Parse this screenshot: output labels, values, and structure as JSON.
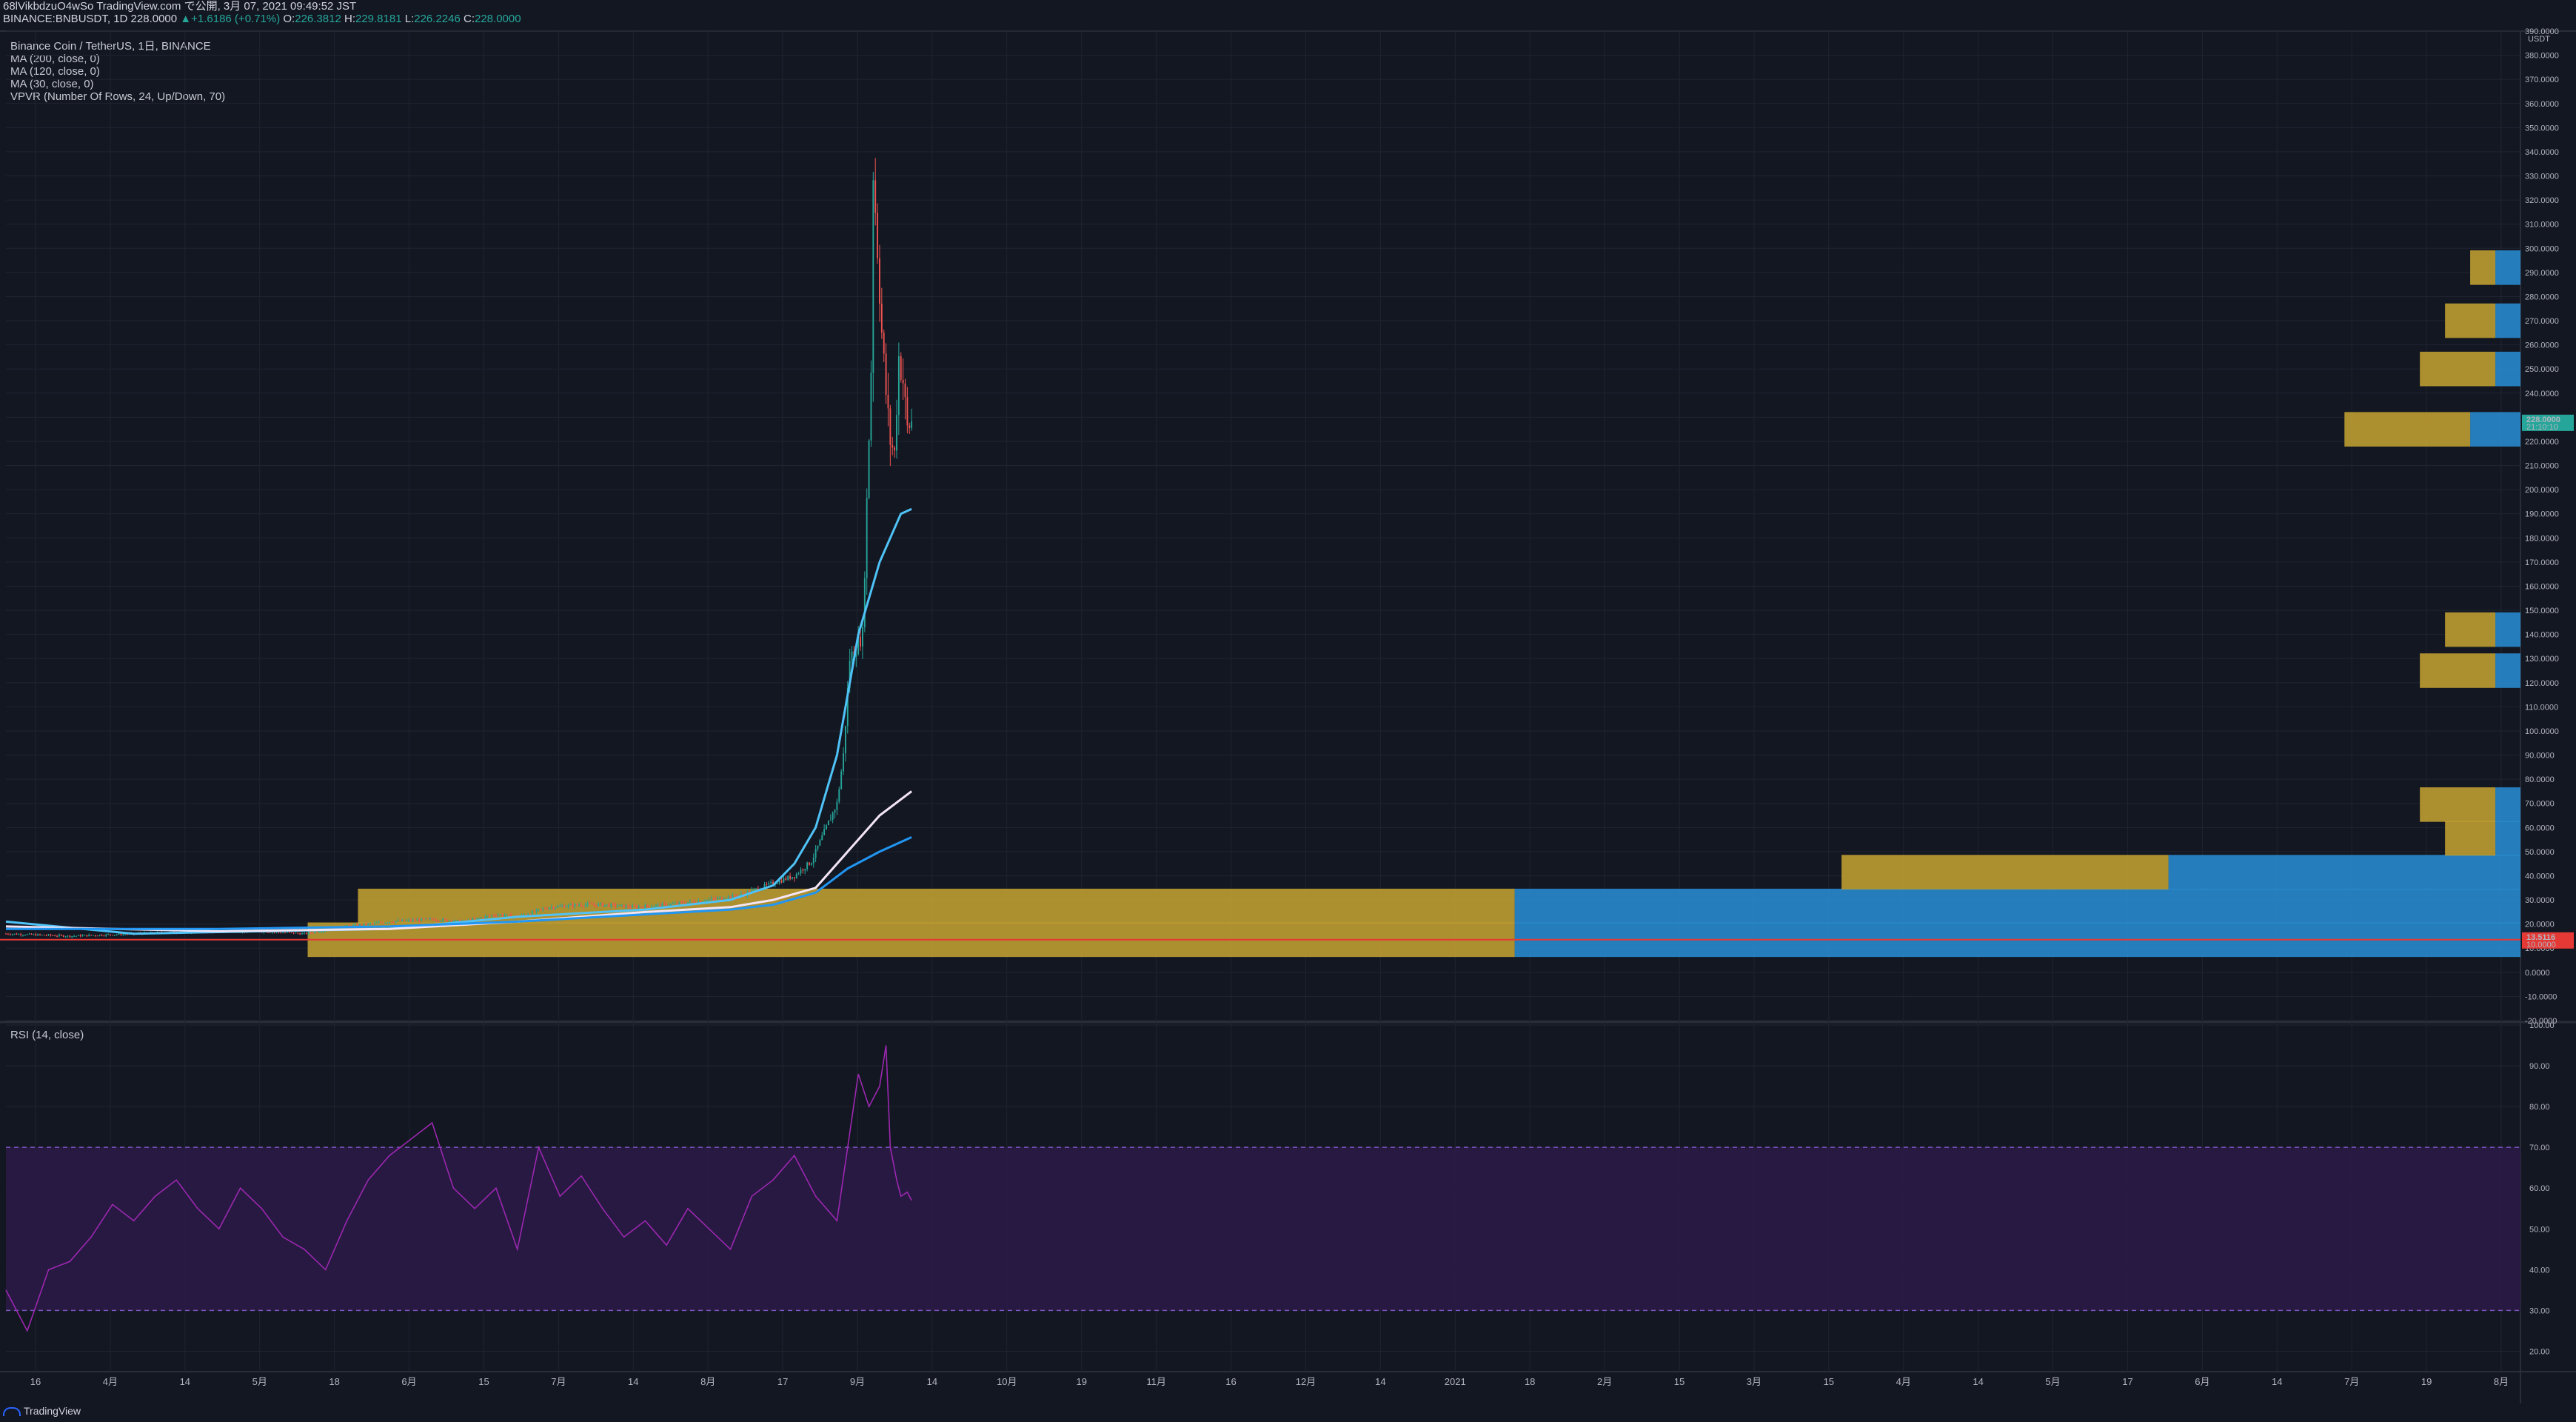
{
  "header": {
    "line1": "68lVikbdzuO4wSo TradingView.com で公開, 3月 07, 2021 09:49:52 JST",
    "line2_prefix": "BINANCE:BNBUSDT, 1D 228.0000",
    "line2_change": "▲+1.6186 (+0.71%)",
    "o_label": "O:",
    "o_val": "226.3812",
    "h_label": "H:",
    "h_val": "229.8181",
    "l_label": "L:",
    "l_val": "226.2246",
    "c_label": "C:",
    "c_val": "228.0000"
  },
  "legend": [
    "Binance Coin / TetherUS, 1日, BINANCE",
    "MA (200, close, 0)",
    "MA (120, close, 0)",
    "MA (30, close, 0)",
    "VPVR (Number Of Rows, 24, Up/Down, 70)"
  ],
  "rsi_label": "RSI (14, close)",
  "currency": "USDT",
  "price_badge": "228.0000",
  "price_badge_sub": "21:10:10",
  "line_badge": "13.5116",
  "line_badge_sub": "10.0000",
  "brand": "TradingView",
  "colors": {
    "bg": "#131722",
    "grid": "#1f2430",
    "up": "#26a69a",
    "down": "#ef5350",
    "ma30": "#4fc3f7",
    "ma120": "#f3e5f5",
    "ma200": "#2196f3",
    "rsi": "#9c27b0",
    "rsi_band": "#2a1a45",
    "hline": "#e53935",
    "vpvr_up": "#2a8fd6",
    "vpvr_down": "#c8a431"
  },
  "chart_data": [
    {
      "type": "candlestick",
      "title": "Binance Coin / TetherUS, 1日, BINANCE",
      "ylabel": "USDT",
      "ylim": [
        -20,
        390
      ],
      "y_ticks": [
        "-20.0000",
        "-10.0000",
        "0.0000",
        "10.0000",
        "20.0000",
        "30.0000",
        "40.0000",
        "50.0000",
        "60.0000",
        "70.0000",
        "80.0000",
        "90.0000",
        "100.0000",
        "110.0000",
        "120.0000",
        "130.0000",
        "140.0000",
        "150.0000",
        "160.0000",
        "170.0000",
        "180.0000",
        "190.0000",
        "200.0000",
        "210.0000",
        "220.0000",
        "230.0000",
        "240.0000",
        "250.0000",
        "260.0000",
        "270.0000",
        "280.0000",
        "290.0000",
        "300.0000",
        "310.0000",
        "320.0000",
        "330.0000",
        "340.0000",
        "350.0000",
        "360.0000",
        "370.0000",
        "380.0000",
        "390.0000"
      ],
      "x_ticks": [
        "16",
        "4月",
        "14",
        "5月",
        "18",
        "6月",
        "15",
        "7月",
        "14",
        "8月",
        "17",
        "9月",
        "14",
        "10月",
        "19",
        "11月",
        "16",
        "12月",
        "14",
        "2021",
        "18",
        "2月",
        "15",
        "3月",
        "15",
        "4月",
        "14",
        "5月",
        "17",
        "6月",
        "14",
        "7月",
        "19",
        "8月"
      ],
      "price_path": [
        [
          0,
          16
        ],
        [
          30,
          15
        ],
        [
          60,
          16
        ],
        [
          90,
          17
        ],
        [
          120,
          17
        ],
        [
          140,
          16
        ],
        [
          160,
          19
        ],
        [
          180,
          21
        ],
        [
          200,
          22
        ],
        [
          215,
          21
        ],
        [
          230,
          24
        ],
        [
          240,
          23
        ],
        [
          255,
          27
        ],
        [
          270,
          28
        ],
        [
          280,
          28
        ],
        [
          295,
          27
        ],
        [
          310,
          28
        ],
        [
          330,
          30
        ],
        [
          345,
          32
        ],
        [
          360,
          37
        ],
        [
          370,
          40
        ],
        [
          378,
          46
        ],
        [
          385,
          60
        ],
        [
          390,
          70
        ],
        [
          393,
          90
        ],
        [
          396,
          130
        ],
        [
          399,
          135
        ],
        [
          402,
          140
        ],
        [
          404,
          195
        ],
        [
          406,
          250
        ],
        [
          407,
          332
        ],
        [
          409,
          300
        ],
        [
          411,
          265
        ],
        [
          413,
          240
        ],
        [
          415,
          220
        ],
        [
          417,
          215
        ],
        [
          419,
          255
        ],
        [
          421,
          245
        ],
        [
          423,
          225
        ],
        [
          425,
          228
        ]
      ],
      "last_price": 228.0,
      "horizontal_line": 13.5116,
      "series": [
        {
          "name": "MA (30, close, 0)",
          "points": [
            [
              0,
              21
            ],
            [
              60,
              16
            ],
            [
              120,
              17
            ],
            [
              180,
              18
            ],
            [
              240,
              23
            ],
            [
              300,
              26
            ],
            [
              340,
              30
            ],
            [
              360,
              36
            ],
            [
              370,
              45
            ],
            [
              380,
              60
            ],
            [
              390,
              90
            ],
            [
              400,
              140
            ],
            [
              410,
              170
            ],
            [
              420,
              190
            ],
            [
              425,
              192
            ]
          ]
        },
        {
          "name": "MA (120, close, 0)",
          "points": [
            [
              0,
              19
            ],
            [
              100,
              17
            ],
            [
              180,
              18
            ],
            [
              240,
              21
            ],
            [
              300,
              25
            ],
            [
              340,
              27
            ],
            [
              360,
              30
            ],
            [
              380,
              35
            ],
            [
              395,
              50
            ],
            [
              410,
              65
            ],
            [
              425,
              75
            ]
          ]
        },
        {
          "name": "MA (200, close, 0)",
          "points": [
            [
              0,
              18
            ],
            [
              100,
              18
            ],
            [
              180,
              19
            ],
            [
              240,
              21
            ],
            [
              300,
              24
            ],
            [
              340,
              26
            ],
            [
              360,
              28
            ],
            [
              380,
              33
            ],
            [
              395,
              43
            ],
            [
              410,
              50
            ],
            [
              425,
              56
            ]
          ]
        }
      ]
    },
    {
      "type": "volume_profile",
      "name": "VPVR (Number Of Rows, 24, Up/Down, 70)",
      "rows": [
        {
          "y": 13.5,
          "up": 0.4,
          "down": 0.48
        },
        {
          "y": 27.5,
          "up": 0.4,
          "down": 0.46
        },
        {
          "y": 41.5,
          "up": 0.14,
          "down": 0.13
        },
        {
          "y": 55.5,
          "up": 0.01,
          "down": 0.02
        },
        {
          "y": 69.5,
          "up": 0.01,
          "down": 0.03
        },
        {
          "y": 125.0,
          "up": 0.01,
          "down": 0.03
        },
        {
          "y": 142.0,
          "up": 0.01,
          "down": 0.02
        },
        {
          "y": 225.0,
          "up": 0.02,
          "down": 0.05
        },
        {
          "y": 250.0,
          "up": 0.01,
          "down": 0.03
        },
        {
          "y": 270.0,
          "up": 0.01,
          "down": 0.02
        },
        {
          "y": 292.0,
          "up": 0.01,
          "down": 0.01
        }
      ]
    },
    {
      "type": "line",
      "name": "RSI (14, close)",
      "ylim": [
        15,
        100
      ],
      "y_ticks": [
        "20.00",
        "30.00",
        "40.00",
        "50.00",
        "60.00",
        "70.00",
        "80.00",
        "90.00",
        "100.00"
      ],
      "bands": [
        30,
        70
      ],
      "points": [
        [
          0,
          35
        ],
        [
          10,
          25
        ],
        [
          20,
          40
        ],
        [
          30,
          42
        ],
        [
          40,
          48
        ],
        [
          50,
          56
        ],
        [
          60,
          52
        ],
        [
          70,
          58
        ],
        [
          80,
          62
        ],
        [
          90,
          55
        ],
        [
          100,
          50
        ],
        [
          110,
          60
        ],
        [
          120,
          55
        ],
        [
          130,
          48
        ],
        [
          140,
          45
        ],
        [
          150,
          40
        ],
        [
          160,
          52
        ],
        [
          170,
          62
        ],
        [
          180,
          68
        ],
        [
          190,
          72
        ],
        [
          200,
          76
        ],
        [
          210,
          60
        ],
        [
          220,
          55
        ],
        [
          230,
          60
        ],
        [
          240,
          45
        ],
        [
          250,
          70
        ],
        [
          260,
          58
        ],
        [
          270,
          63
        ],
        [
          280,
          55
        ],
        [
          290,
          48
        ],
        [
          300,
          52
        ],
        [
          310,
          46
        ],
        [
          320,
          55
        ],
        [
          330,
          50
        ],
        [
          340,
          45
        ],
        [
          350,
          58
        ],
        [
          360,
          62
        ],
        [
          370,
          68
        ],
        [
          380,
          58
        ],
        [
          390,
          52
        ],
        [
          395,
          70
        ],
        [
          400,
          88
        ],
        [
          405,
          80
        ],
        [
          410,
          85
        ],
        [
          413,
          95
        ],
        [
          415,
          70
        ],
        [
          418,
          62
        ],
        [
          420,
          58
        ],
        [
          423,
          59
        ],
        [
          425,
          57
        ]
      ]
    }
  ]
}
